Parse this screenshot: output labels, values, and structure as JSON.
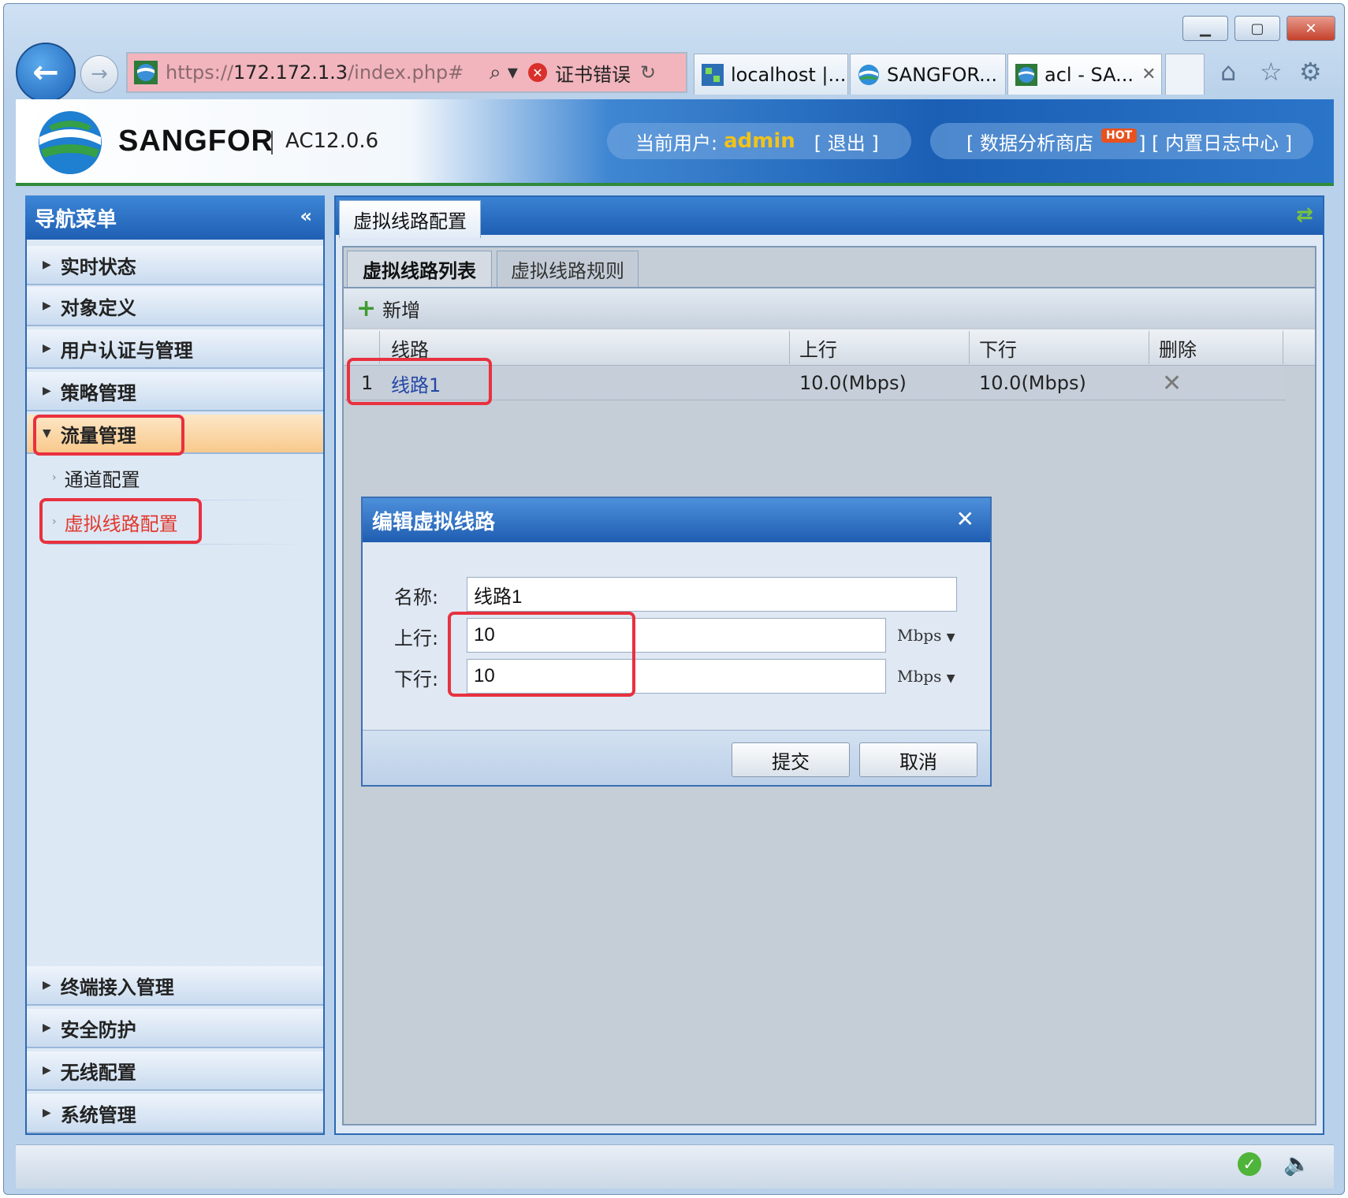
{
  "browser": {
    "window_controls": {
      "minimize": "▭",
      "maximize": "▢",
      "close": "✕"
    },
    "address": {
      "url_prefix": "https://",
      "url_host": "172.172.1.3",
      "url_path": "/index.php#",
      "cert_error": "证书错误"
    },
    "tabs": [
      {
        "label": "localhost |..."
      },
      {
        "label": "SANGFOR..."
      },
      {
        "label": "acl - SA..."
      }
    ],
    "icons": {
      "search": "search-icon",
      "home": "home-icon",
      "favorites": "star-icon",
      "tools": "gear-icon"
    }
  },
  "header": {
    "brand": "SANGFOR",
    "version": "AC12.0.6",
    "current_user_label": "当前用户:",
    "username": "admin",
    "logout": "[ 退出 ]",
    "data_store": "[ 数据分析商店",
    "hot": "HOT",
    "log_center": "] [ 内置日志中心 ]"
  },
  "sidebar": {
    "title": "导航菜单",
    "top_items": [
      {
        "label": "实时状态"
      },
      {
        "label": "对象定义"
      },
      {
        "label": "用户认证与管理"
      },
      {
        "label": "策略管理"
      },
      {
        "label": "流量管理"
      }
    ],
    "sub_items": [
      {
        "label": "通道配置"
      },
      {
        "label": "虚拟线路配置"
      }
    ],
    "bottom_items": [
      {
        "label": "终端接入管理"
      },
      {
        "label": "安全防护"
      },
      {
        "label": "无线配置"
      },
      {
        "label": "系统管理"
      }
    ]
  },
  "main": {
    "tab": "虚拟线路配置",
    "subtabs": [
      "虚拟线路列表",
      "虚拟线路规则"
    ],
    "toolbar": {
      "add": "新增"
    },
    "table": {
      "headers": [
        "线路",
        "上行",
        "下行",
        "删除"
      ],
      "rows": [
        {
          "index": "1",
          "name": "线路1",
          "up": "10.0(Mbps)",
          "down": "10.0(Mbps)"
        }
      ]
    }
  },
  "dialog": {
    "title": "编辑虚拟线路",
    "name_label": "名称:",
    "name_value": "线路1",
    "up_label": "上行:",
    "up_value": "10",
    "up_unit": "Mbps",
    "down_label": "下行:",
    "down_value": "10",
    "down_unit": "Mbps",
    "submit": "提交",
    "cancel": "取消"
  },
  "colors": {
    "accent_blue": "#1f5fb3",
    "annotation_red": "#e8313f",
    "active_nav": "#f8c98c",
    "current_link": "#e2382d",
    "admin_name": "#f0c21b"
  }
}
